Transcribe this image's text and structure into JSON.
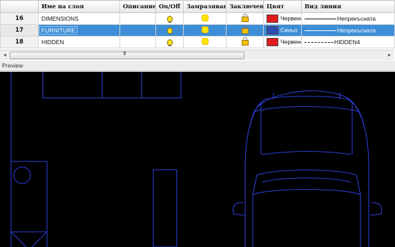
{
  "layers_table": {
    "headers": [
      "",
      "Име на слоя",
      "Описание",
      "On/Off",
      "Замразяване",
      "Заключен",
      "Цвят",
      "Вид линия"
    ],
    "rows": [
      {
        "num": "16",
        "name": "DIMENSIONS",
        "description": "",
        "on": "on",
        "frozen": "no",
        "locked": "no",
        "color_name": "Червено",
        "color_hex": "#e11b1b",
        "linetype": "Непрекъсната",
        "selected": false
      },
      {
        "num": "17",
        "name": "FURNITURE",
        "description": "",
        "on": "on",
        "frozen": "no",
        "locked": "no",
        "color_name": "Синьо",
        "color_hex": "#2b4bb3",
        "linetype": "Непрекъсната",
        "selected": true
      },
      {
        "num": "18",
        "name": "HIDDEN",
        "description": "",
        "on": "on",
        "frozen": "no",
        "locked": "no",
        "color_name": "Червено",
        "color_hex": "#e11b1b",
        "linetype": "HIDDEN4",
        "selected": false
      }
    ]
  },
  "scrollbar": {
    "grip": "III",
    "left_arrow": "◂",
    "right_arrow": "▸"
  },
  "preview": {
    "label": "Preview",
    "background": "#000000",
    "line_color": "#2d3fd6"
  },
  "colors": {
    "selection": "#3d8ed7",
    "red": "#e11b1b",
    "blue": "#2b4bb3"
  }
}
